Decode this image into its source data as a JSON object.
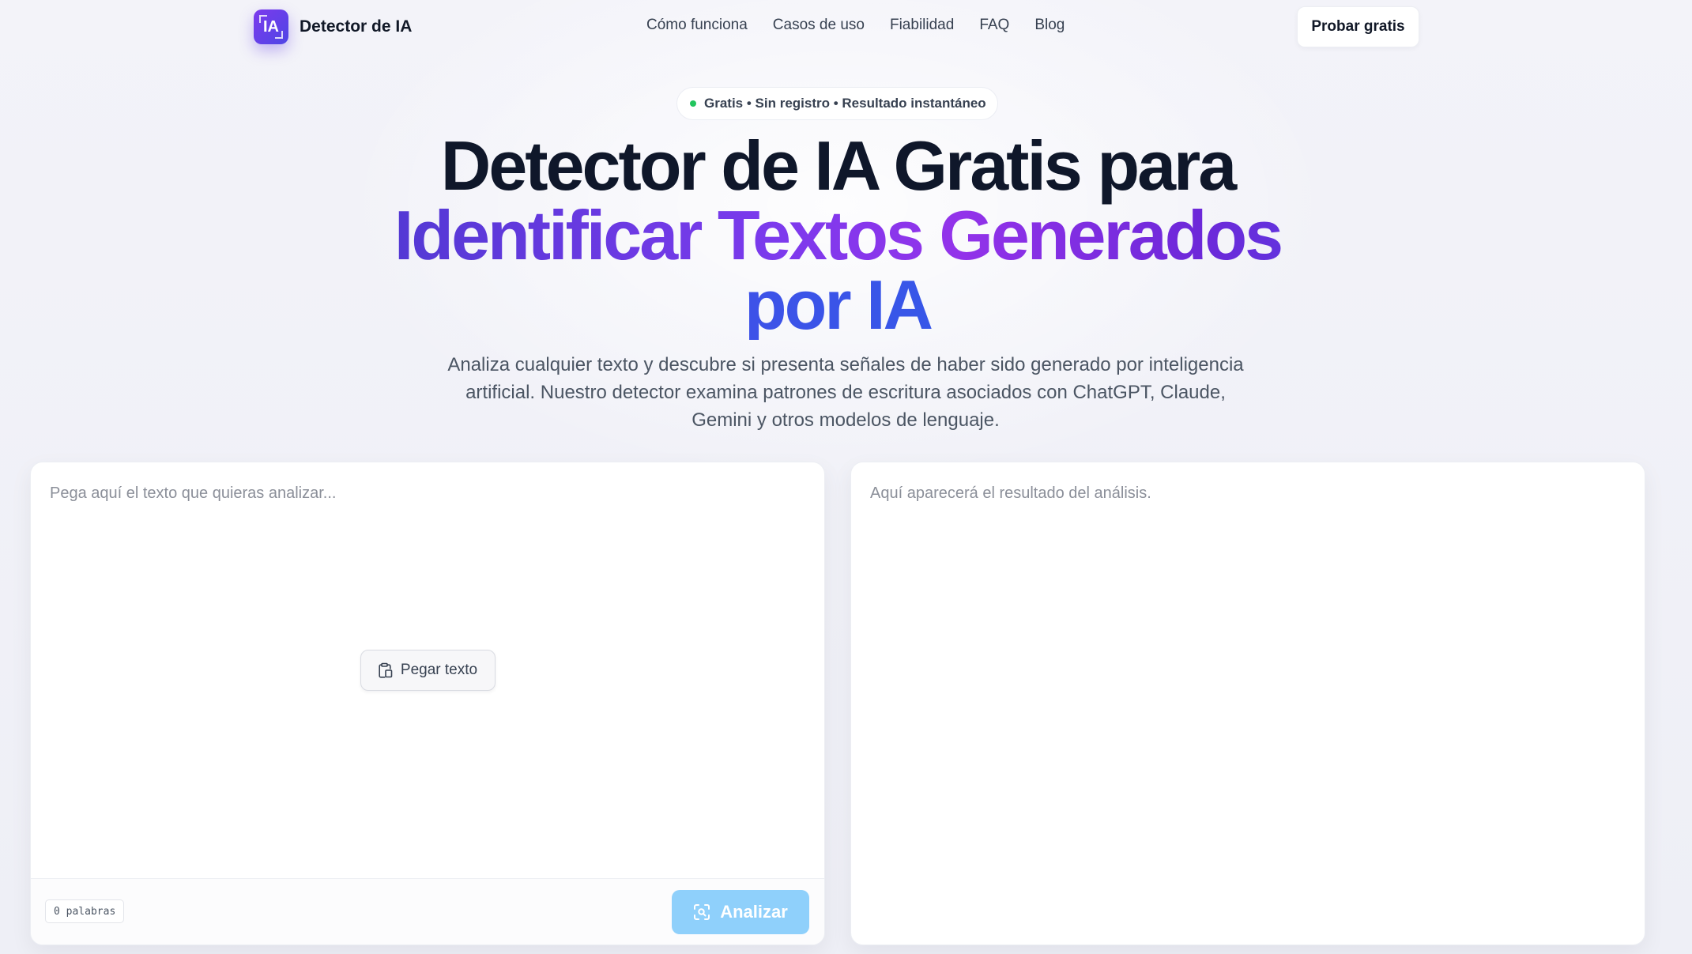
{
  "brand": {
    "logo_mark": "IA",
    "name": "Detector de IA",
    "accent_colors": [
      "#7c3aed",
      "#4f46e5",
      "#2563eb"
    ]
  },
  "nav": {
    "links": [
      "Cómo funciona",
      "Casos de uso",
      "Fiabilidad",
      "FAQ",
      "Blog"
    ],
    "cta_label": "Probar gratis"
  },
  "hero": {
    "badge_text": "Gratis • Sin registro • Resultado instantáneo",
    "title_line1": "Detector de IA Gratis para",
    "title_line2": "Identificar Textos Generados",
    "title_line3": "por IA",
    "subtitle": "Analiza cualquier texto y descubre si presenta señales de haber sido generado por inteligencia artificial. Nuestro detector examina patrones de escritura asociados con ChatGPT, Claude, Gemini y otros modelos de lenguaje."
  },
  "input_panel": {
    "placeholder": "Pega aquí el texto que quieras analizar...",
    "value": "",
    "paste_button_label": "Pegar texto",
    "paste_icon": "clipboard-icon",
    "word_count": "0 palabras",
    "analyze_button_label": "Analizar",
    "analyze_icon": "scan-icon",
    "analyze_button_color": "#8fd0fb"
  },
  "result_panel": {
    "placeholder": "Aquí aparecerá el resultado del análisis."
  }
}
